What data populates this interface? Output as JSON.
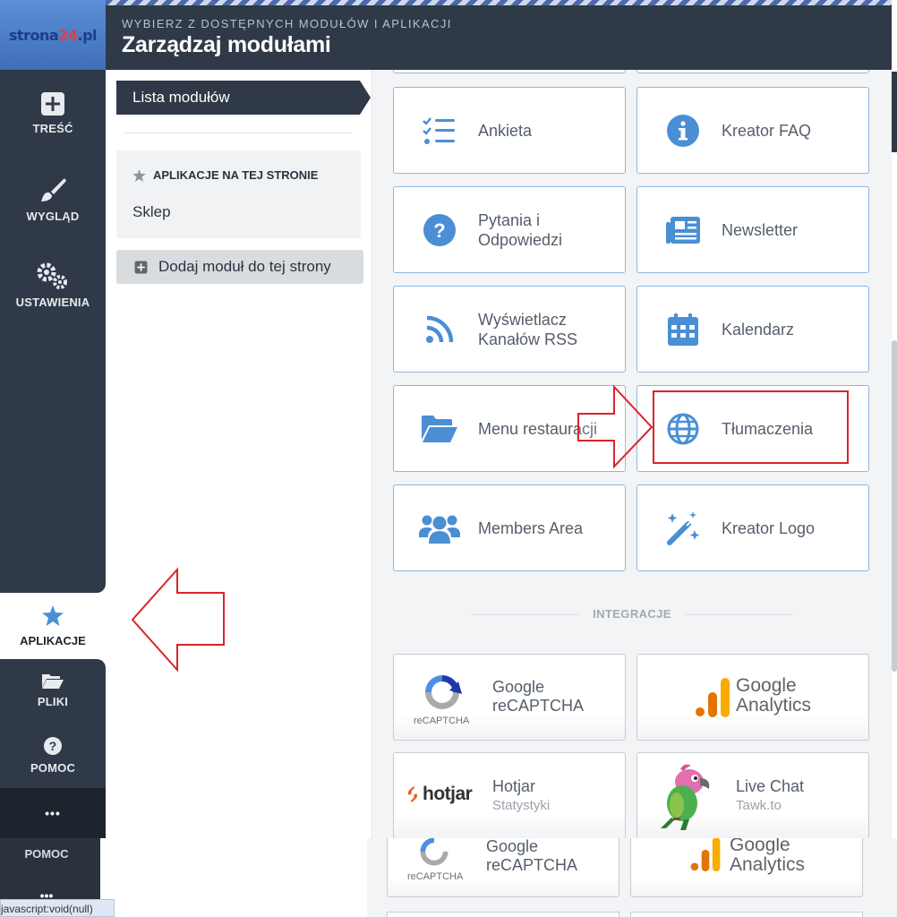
{
  "brand": {
    "logo_main": "strona",
    "logo_accent": "24",
    "logo_suffix": ".pl"
  },
  "header": {
    "subtitle": "WYBIERZ Z DOSTĘPNYCH MODUŁÓW I APLIKACJI",
    "title": "Zarządzaj modułami"
  },
  "rail": {
    "items": [
      {
        "label": "TREŚĆ",
        "icon": "plus-square-icon"
      },
      {
        "label": "WYGLĄD",
        "icon": "paint-brush-icon"
      },
      {
        "label": "USTAWIENIA",
        "icon": "gears-icon"
      }
    ],
    "active": {
      "label": "APLIKACJE",
      "icon": "star-icon"
    },
    "bottom": [
      {
        "label": "PLIKI",
        "icon": "folder-open-icon"
      },
      {
        "label": "POMOC",
        "icon": "question-circle-icon"
      }
    ],
    "more": "•••",
    "ghost_label": "POMOC",
    "ghost_more": "•••"
  },
  "status_url": "javascript:void(null)",
  "panel": {
    "tab": "Lista modułów",
    "apps_heading": "APLIKACJE NA TEJ STRONIE",
    "apps_items": [
      "Sklep"
    ],
    "add_button": "Dodaj moduł do tej strony"
  },
  "modules": [
    {
      "label": "Ankieta",
      "icon": "list-check-icon"
    },
    {
      "label": "Kreator FAQ",
      "icon": "info-circle-icon"
    },
    {
      "label": "Pytania i\nOdpowiedzi",
      "icon": "question-circle-icon"
    },
    {
      "label": "Newsletter",
      "icon": "newspaper-icon"
    },
    {
      "label": "Wyświetlacz\nKanałów RSS",
      "icon": "rss-icon"
    },
    {
      "label": "Kalendarz",
      "icon": "calendar-icon"
    },
    {
      "label": "Menu restauracji",
      "icon": "folder-open-icon"
    },
    {
      "label": "Tłumaczenia",
      "icon": "globe-icon"
    },
    {
      "label": "Members Area",
      "icon": "users-icon"
    },
    {
      "label": "Kreator Logo",
      "icon": "magic-wand-icon"
    }
  ],
  "integrations_heading": "INTEGRACJE",
  "integrations": [
    {
      "title": "Google\nreCAPTCHA",
      "sub": "",
      "logo_text": "reCAPTCHA",
      "icon": "recaptcha-icon"
    },
    {
      "title": "Google\nAnalytics",
      "sub": "",
      "icon": "google-analytics-icon"
    },
    {
      "title": "Hotjar",
      "sub": "Statystyki",
      "logo_text": "hotjar",
      "icon": "hotjar-icon"
    },
    {
      "title": "Live Chat",
      "sub": "Tawk.to",
      "icon": "tawk-parrot-icon"
    }
  ],
  "ghost_integrations": [
    {
      "title": "Google\nreCAPTCHA",
      "logo_text": "reCAPTCHA"
    },
    {
      "title": "Google\nAnalytics"
    }
  ],
  "colors": {
    "rail": "#2f3947",
    "accent_blue": "#4a8fd4",
    "annotation_red": "#d9242a",
    "card_border": "#8fb6e0"
  }
}
